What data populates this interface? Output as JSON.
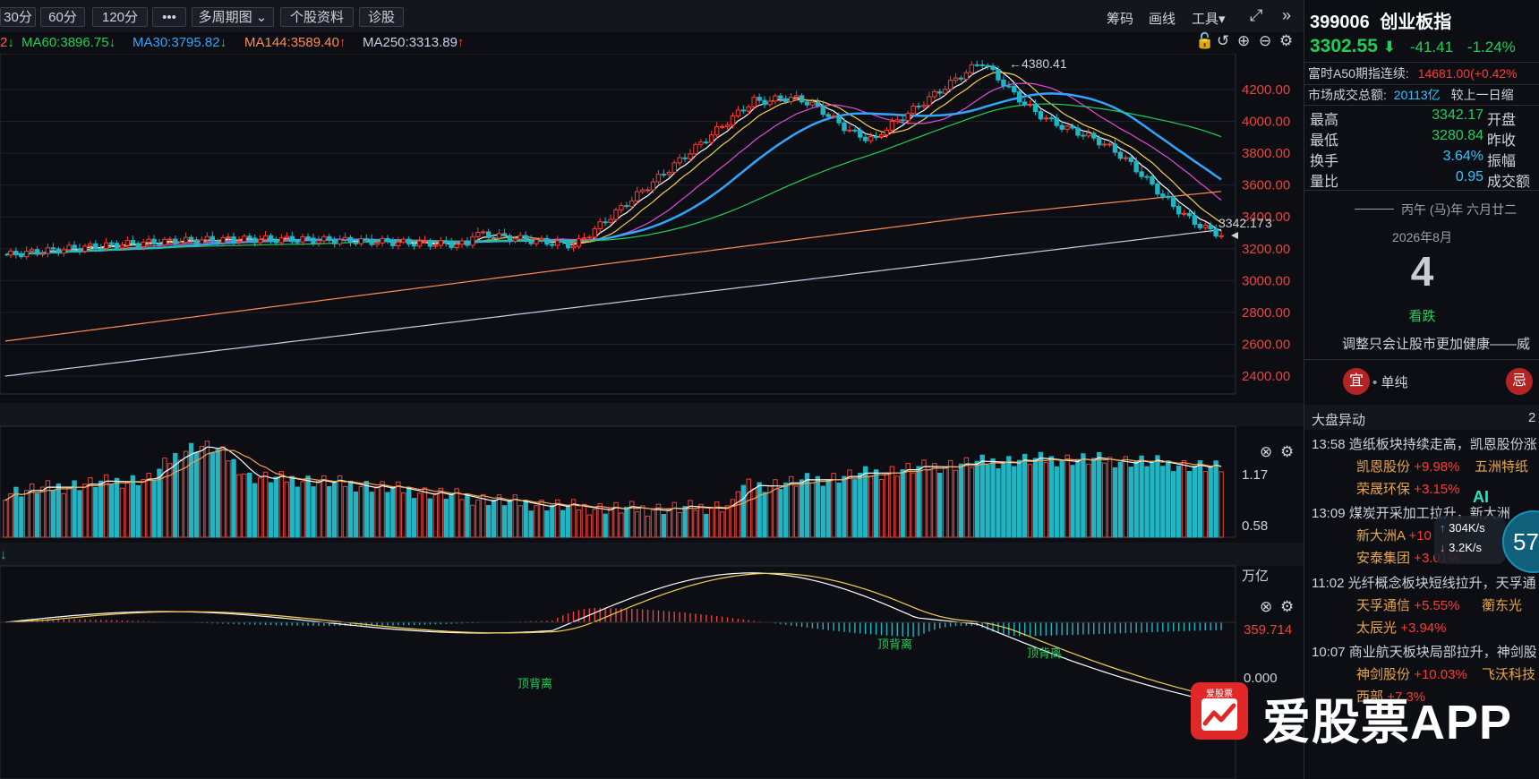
{
  "toolbar": {
    "periods": [
      "30分",
      "60分",
      "120分",
      "•••",
      "多周期图",
      "个股资料",
      "诊股"
    ],
    "right_tools": [
      "筹码",
      "画线",
      "工具",
      "⤢",
      "»"
    ]
  },
  "ma_legend": [
    {
      "label": "2",
      "arrow": "↓",
      "color": "#ff5d5d"
    },
    {
      "label": "MA60:3896.75",
      "arrow": "↓",
      "color": "#1fcf5a"
    },
    {
      "label": "MA30:3795.82",
      "arrow": "↓",
      "color": "#2fa6ff"
    },
    {
      "label": "MA144:3589.40",
      "arrow": "↑",
      "color": "#ff8a54"
    },
    {
      "label": "MA250:3313.89",
      "arrow": "↑",
      "color": "#c7cfe6"
    }
  ],
  "main_chart": {
    "y_ticks": [
      "4200.00",
      "4000.00",
      "3800.00",
      "3600.00",
      "3400.00",
      "3200.00",
      "3000.00",
      "2800.00",
      "2600.00",
      "2400.00"
    ],
    "high_marker": "←4380.41",
    "right_marker": "3342.17",
    "right_marker_2": "3"
  },
  "volume_chart": {
    "y_ticks": [
      "1.17",
      "0.58"
    ],
    "unit": "万亿"
  },
  "macd_chart": {
    "y_ticks": [
      "359.714",
      "0.000"
    ],
    "annotations": [
      "顶背离",
      "顶背离",
      "顶背离"
    ],
    "left_arrow": "↓"
  },
  "panel": {
    "code": "399006",
    "name": "创业板指",
    "price": "3302.55",
    "price_arrow": "⬇",
    "change": "-41.41",
    "change_pct": "-1.24%",
    "a50_label": "富时A50期指连续:",
    "a50_value": "14681.00(+0.42%",
    "turnover_label": "市场成交总额:",
    "turnover_value": "20113亿",
    "turnover_note": "较上一日缩",
    "stats": [
      {
        "label": "最高",
        "value": "3342.17",
        "tail": "开盘"
      },
      {
        "label": "最低",
        "value": "3280.84",
        "tail": "昨收"
      },
      {
        "label": "换手",
        "value": "3.64%",
        "tail": "振幅"
      },
      {
        "label": "量比",
        "value": "0.95",
        "tail": "成交额"
      }
    ],
    "lunar": "丙午 (马)年 六月廿二",
    "month": "2026年8月",
    "day": "4",
    "mood": "看跌",
    "quote": "调整只会让股市更加健康——威",
    "yi": "宜",
    "yi_text": "单纯",
    "ji": "忌",
    "news_title": "大盘异动",
    "news_more": "2",
    "news": [
      {
        "time": "13:58",
        "text": "造纸板块持续走高，凯恩股份涨",
        "stocks": [
          [
            "凯恩股份",
            "+9.98%",
            "五洲特纸"
          ],
          [
            "荣晟环保",
            "+3.15%",
            ""
          ]
        ]
      },
      {
        "time": "13:09",
        "text": "煤炭开采加工拉升，新大洲",
        "stocks": [
          [
            "新大洲A",
            "+10",
            ""
          ],
          [
            "安泰集团",
            "+3.01%",
            ""
          ]
        ]
      },
      {
        "time": "11:02",
        "text": "光纤概念板块短线拉升，天孚通",
        "stocks": [
          [
            "天孚通信",
            "+5.55%",
            "蘅东光"
          ],
          [
            "太辰光",
            "+3.94%",
            ""
          ]
        ]
      },
      {
        "time": "10:07",
        "text": "商业航天板块局部拉升，神剑股",
        "stocks": [
          [
            "神剑股份",
            "+10.03%",
            "飞沃科技"
          ],
          [
            "西部",
            "+7.3%",
            ""
          ]
        ]
      }
    ],
    "net_up": "304K/s",
    "net_down": "3.2K/s",
    "net_badge": "57",
    "ai_badge": "AI"
  },
  "watermark": {
    "logo_text": "爱股票",
    "text": "爱股票APP"
  }
}
